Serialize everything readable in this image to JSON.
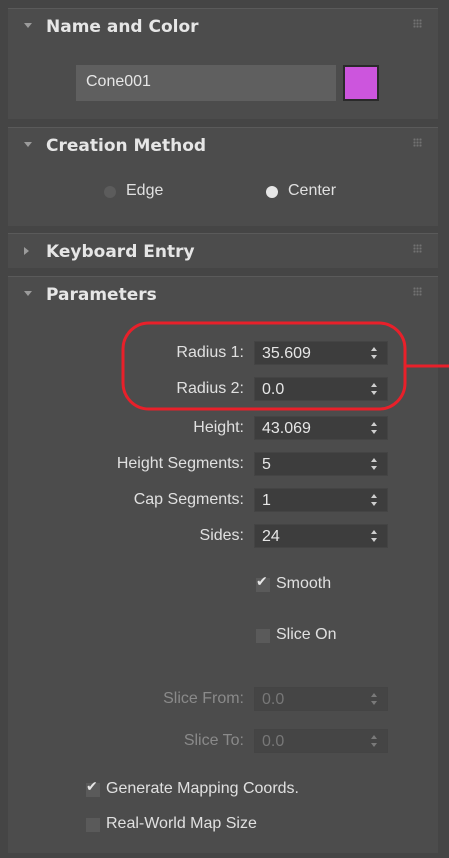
{
  "rollouts": {
    "name_color": {
      "title": "Name and Color",
      "object_name": "Cone001",
      "color": "#cc55dd"
    },
    "creation_method": {
      "title": "Creation Method",
      "options": [
        {
          "label": "Edge",
          "selected": false
        },
        {
          "label": "Center",
          "selected": true
        }
      ]
    },
    "keyboard_entry": {
      "title": "Keyboard Entry"
    },
    "parameters": {
      "title": "Parameters",
      "fields": [
        {
          "label": "Radius 1:",
          "value": "35.609"
        },
        {
          "label": "Radius 2:",
          "value": "0.0"
        },
        {
          "label": "Height:",
          "value": "43.069"
        },
        {
          "label": "Height Segments:",
          "value": "5"
        },
        {
          "label": "Cap Segments:",
          "value": "1"
        },
        {
          "label": "Sides:",
          "value": "24"
        }
      ],
      "smooth": {
        "label": "Smooth",
        "checked": true
      },
      "slice_on": {
        "label": "Slice On",
        "checked": false
      },
      "slice_from": {
        "label": "Slice From:",
        "value": "0.0"
      },
      "slice_to": {
        "label": "Slice To:",
        "value": "0.0"
      },
      "gen_mapping": {
        "label": "Generate Mapping Coords.",
        "checked": true
      },
      "real_world": {
        "label": "Real-World Map Size",
        "checked": false
      }
    }
  },
  "annotation": {
    "color": "#e8202a"
  }
}
